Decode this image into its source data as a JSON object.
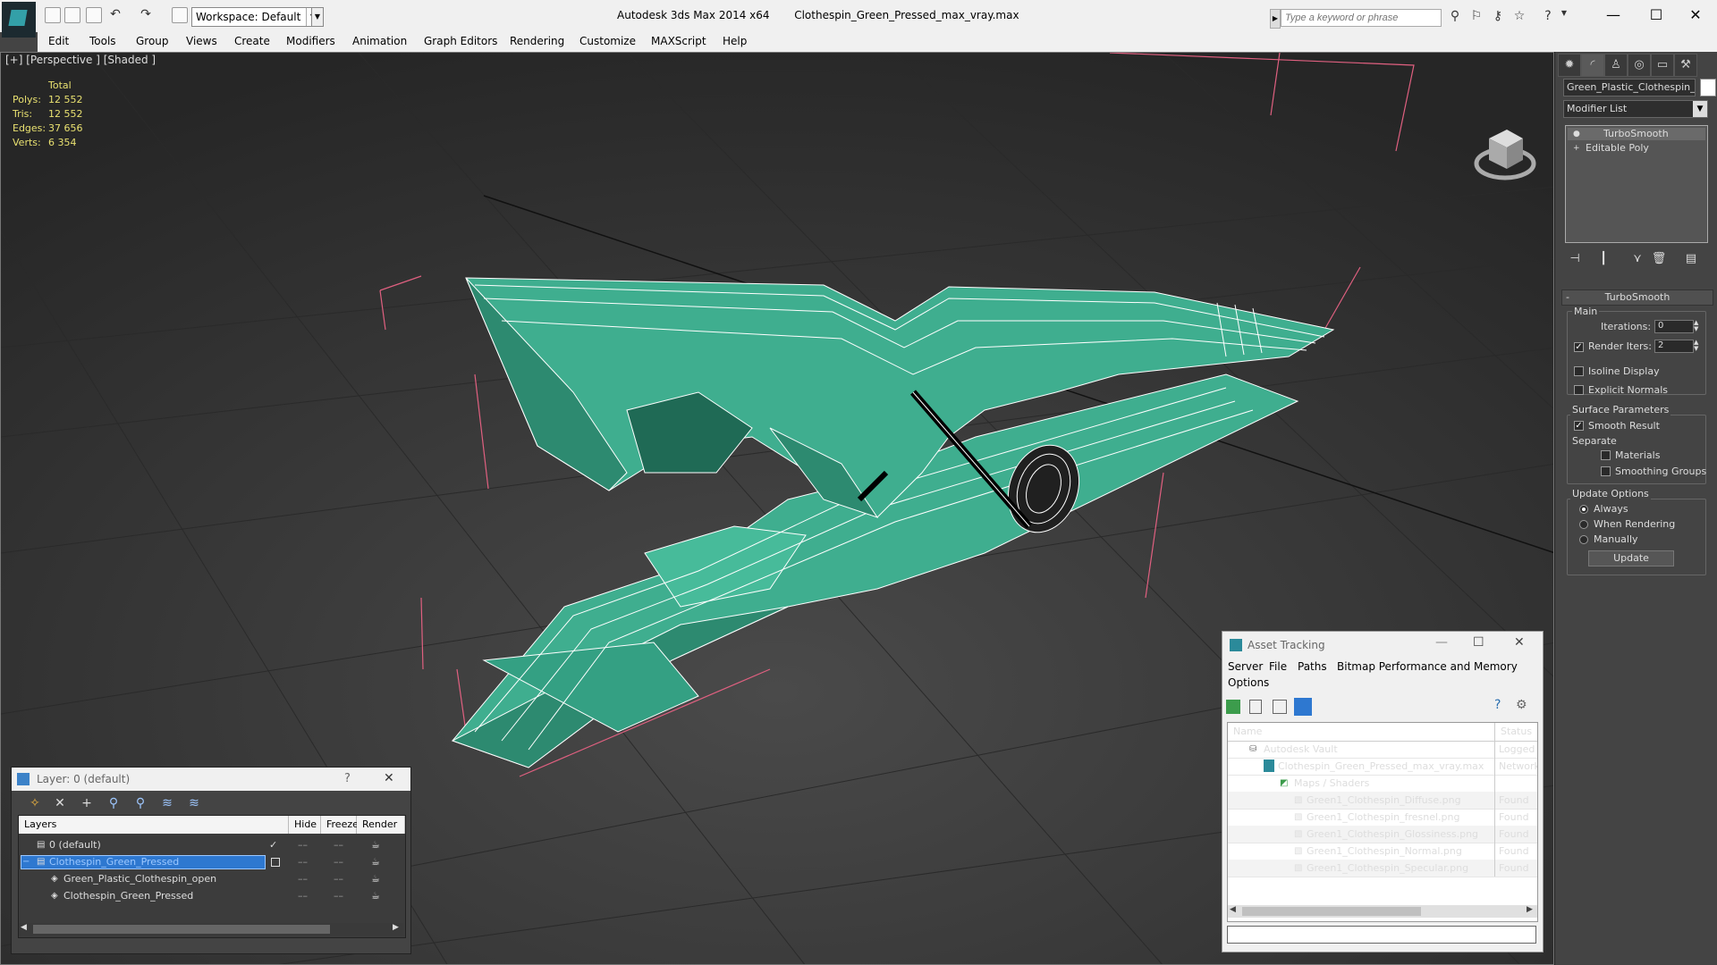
{
  "titlebar": {
    "workspace": "Workspace: Default",
    "app_name": "Autodesk 3ds Max  2014 x64",
    "file_name": "Clothespin_Green_Pressed_max_vray.max",
    "search_placeholder": "Type a keyword or phrase",
    "controls": {
      "minimize": "—",
      "maximize": "☐",
      "close": "✕"
    }
  },
  "menubar": {
    "items": [
      "Edit",
      "Tools",
      "Group",
      "Views",
      "Create",
      "Modifiers",
      "Animation",
      "Graph Editors",
      "Rendering",
      "Customize",
      "MAXScript",
      "Help"
    ]
  },
  "viewport": {
    "label": "[+] [Perspective ] [Shaded ]",
    "stats": {
      "header": "Total",
      "rows": [
        {
          "key": "Polys:",
          "value": "12 552"
        },
        {
          "key": "Tris:",
          "value": "12 552"
        },
        {
          "key": "Edges:",
          "value": "37 656"
        },
        {
          "key": "Verts:",
          "value": "6 354"
        }
      ]
    },
    "colors": {
      "mesh": "#3fae8f",
      "mesh_dark": "#2d8a70",
      "wire": "#ffffff",
      "bbox": "#e06080",
      "grid": "#2a2a2a"
    }
  },
  "command_panel": {
    "object_name": "Green_Plastic_Clothespin_open",
    "modifier_list": "Modifier List",
    "stack": [
      "TurboSmooth",
      "Editable Poly"
    ],
    "rollout": {
      "title": "TurboSmooth",
      "main_label": "Main",
      "iterations_label": "Iterations:",
      "iterations_value": "0",
      "render_iters_label": "Render Iters:",
      "render_iters_value": "2",
      "isoline_label": "Isoline Display",
      "explicit_normals_label": "Explicit Normals",
      "surface_params_label": "Surface Parameters",
      "smooth_result_label": "Smooth Result",
      "separate_label": "Separate",
      "materials_label": "Materials",
      "smoothing_groups_label": "Smoothing Groups",
      "update_options_label": "Update Options",
      "always_label": "Always",
      "when_rendering_label": "When Rendering",
      "manually_label": "Manually",
      "update_button": "Update"
    }
  },
  "layer_window": {
    "title": "Layer: 0 (default)",
    "help": "?",
    "close": "✕",
    "columns": [
      "Layers",
      "Hide",
      "Freeze",
      "Render"
    ],
    "rows": [
      {
        "name": "0 (default)",
        "indent": 0,
        "selected": false,
        "current": true
      },
      {
        "name": "Clothespin_Green_Pressed",
        "indent": 0,
        "selected": true,
        "current": false
      },
      {
        "name": "Green_Plastic_Clothespin_open",
        "indent": 1,
        "selected": false,
        "current": false
      },
      {
        "name": "Clothespin_Green_Pressed",
        "indent": 1,
        "selected": false,
        "current": false
      }
    ]
  },
  "asset_tracking": {
    "title": "Asset Tracking",
    "menu": [
      "Server",
      "File",
      "Paths",
      "Bitmap Performance and Memory",
      "Options"
    ],
    "columns": [
      "Name",
      "Status"
    ],
    "rows": [
      {
        "name": "Autodesk Vault",
        "status": "Logged Out",
        "indent": 0
      },
      {
        "name": "Clothespin_Green_Pressed_max_vray.max",
        "status": "Network",
        "indent": 1
      },
      {
        "name": "Maps / Shaders",
        "status": "",
        "indent": 2
      },
      {
        "name": "Green1_Clothespin_Diffuse.png",
        "status": "Found",
        "indent": 3
      },
      {
        "name": "Green1_Clothespin_fresnel.png",
        "status": "Found",
        "indent": 3
      },
      {
        "name": "Green1_Clothespin_Glossiness.png",
        "status": "Found",
        "indent": 3
      },
      {
        "name": "Green1_Clothespin_Normal.png",
        "status": "Found",
        "indent": 3
      },
      {
        "name": "Green1_Clothespin_Specular.png",
        "status": "Found",
        "indent": 3
      }
    ]
  }
}
